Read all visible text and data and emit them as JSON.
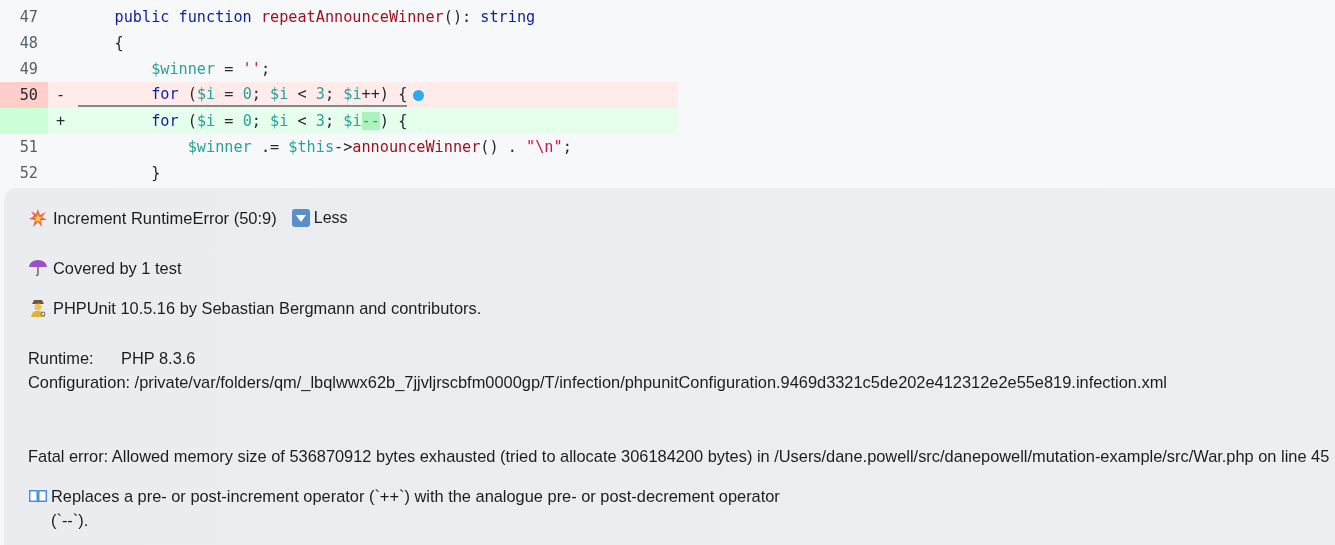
{
  "diff": {
    "lines": [
      {
        "number": "47",
        "kind": "context",
        "tokens": [
          {
            "kind": "keyword",
            "text": "    public function "
          },
          {
            "kind": "fn",
            "text": "repeatAnnounceWinner"
          },
          {
            "kind": "plain",
            "text": "(): "
          },
          {
            "kind": "keyword",
            "text": "string"
          }
        ]
      },
      {
        "number": "48",
        "kind": "context",
        "tokens": [
          {
            "kind": "plain",
            "text": "    {"
          }
        ]
      },
      {
        "number": "49",
        "kind": "context",
        "tokens": [
          {
            "kind": "var",
            "text": "        $winner"
          },
          {
            "kind": "plain",
            "text": " = "
          },
          {
            "kind": "str",
            "text": "''"
          },
          {
            "kind": "plain",
            "text": ";"
          }
        ]
      },
      {
        "number": "50",
        "kind": "removed",
        "marker": "-",
        "underlined": true,
        "dot": true,
        "tokens": [
          {
            "kind": "keyword",
            "text": "        for"
          },
          {
            "kind": "plain",
            "text": " ("
          },
          {
            "kind": "var",
            "text": "$i"
          },
          {
            "kind": "plain",
            "text": " = "
          },
          {
            "kind": "num",
            "text": "0"
          },
          {
            "kind": "plain",
            "text": "; "
          },
          {
            "kind": "var",
            "text": "$i"
          },
          {
            "kind": "plain",
            "text": " < "
          },
          {
            "kind": "num",
            "text": "3"
          },
          {
            "kind": "plain",
            "text": "; "
          },
          {
            "kind": "var",
            "text": "$i"
          },
          {
            "kind": "plain",
            "text": "++) {"
          }
        ]
      },
      {
        "kind": "added",
        "marker": "+",
        "tokens": [
          {
            "kind": "keyword",
            "text": "        for"
          },
          {
            "kind": "plain",
            "text": " ("
          },
          {
            "kind": "var",
            "text": "$i"
          },
          {
            "kind": "plain",
            "text": " = "
          },
          {
            "kind": "num",
            "text": "0"
          },
          {
            "kind": "plain",
            "text": "; "
          },
          {
            "kind": "var",
            "text": "$i"
          },
          {
            "kind": "plain",
            "text": " < "
          },
          {
            "kind": "num",
            "text": "3"
          },
          {
            "kind": "plain",
            "text": "; "
          },
          {
            "kind": "var",
            "text": "$i"
          },
          {
            "kind": "changed",
            "text": "--"
          },
          {
            "kind": "plain",
            "text": ") {"
          }
        ]
      },
      {
        "number": "51",
        "kind": "context",
        "tokens": [
          {
            "kind": "var",
            "text": "            $winner"
          },
          {
            "kind": "plain",
            "text": " .= "
          },
          {
            "kind": "var",
            "text": "$this"
          },
          {
            "kind": "plain",
            "text": "->"
          },
          {
            "kind": "fn",
            "text": "announceWinner"
          },
          {
            "kind": "plain",
            "text": "() . "
          },
          {
            "kind": "str",
            "text": "\"\\n\""
          },
          {
            "kind": "plain",
            "text": ";"
          }
        ]
      },
      {
        "number": "52",
        "kind": "context",
        "tokens": [
          {
            "kind": "plain",
            "text": "        }"
          }
        ]
      }
    ]
  },
  "mutant": {
    "title": "Increment RuntimeError (50:9)",
    "toggle": "Less",
    "coverage": "Covered by 1 test",
    "runner": "PHPUnit 10.5.16 by Sebastian Bergmann and contributors.",
    "runtime": {
      "label": "Runtime:",
      "value": "PHP 8.3.6"
    },
    "configuration": "Configuration: /private/var/folders/qm/_lbqlwwx62b_7jjvljrscbfm0000gp/T/infection/phpunitConfiguration.9469d3321c5de202e412312e2e55e819.infection.xml",
    "fatal_error": "Fatal error: Allowed memory size of 536870912 bytes exhausted (tried to allocate 306184200 bytes) in /Users/dane.powell/src/danepowell/mutation-example/src/War.php on line 45",
    "description": "Replaces a pre- or post-increment operator (`++`) with the analogue pre- or post-decrement operator (`--`)."
  }
}
